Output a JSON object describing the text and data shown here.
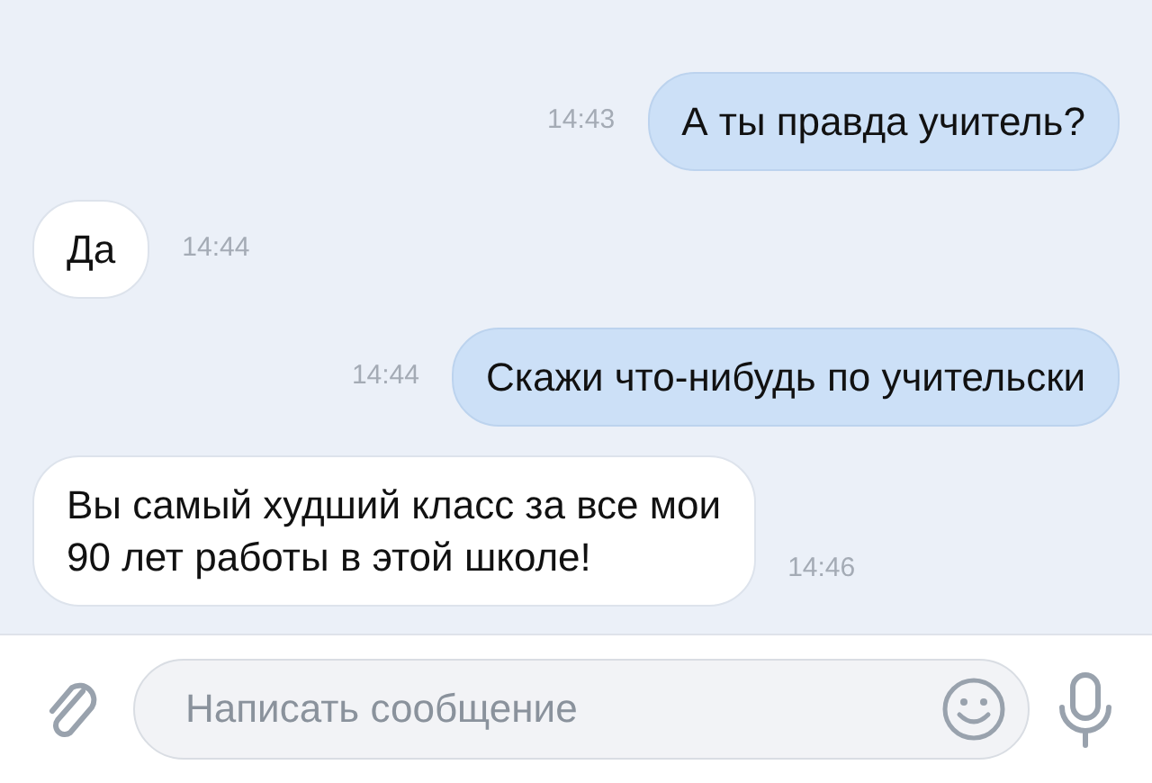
{
  "messages": [
    {
      "kind": "outgoing",
      "text": "А ты правда учитель?",
      "time": "14:43"
    },
    {
      "kind": "incoming",
      "text": "Да",
      "time": "14:44"
    },
    {
      "kind": "outgoing",
      "text": "Скажи что-нибудь по учительски",
      "time": "14:44"
    },
    {
      "kind": "incoming",
      "text": "Вы самый худший класс за все мои\n90 лет работы в этой школе!",
      "time": "14:46"
    }
  ],
  "composer": {
    "placeholder": "Написать сообщение"
  }
}
